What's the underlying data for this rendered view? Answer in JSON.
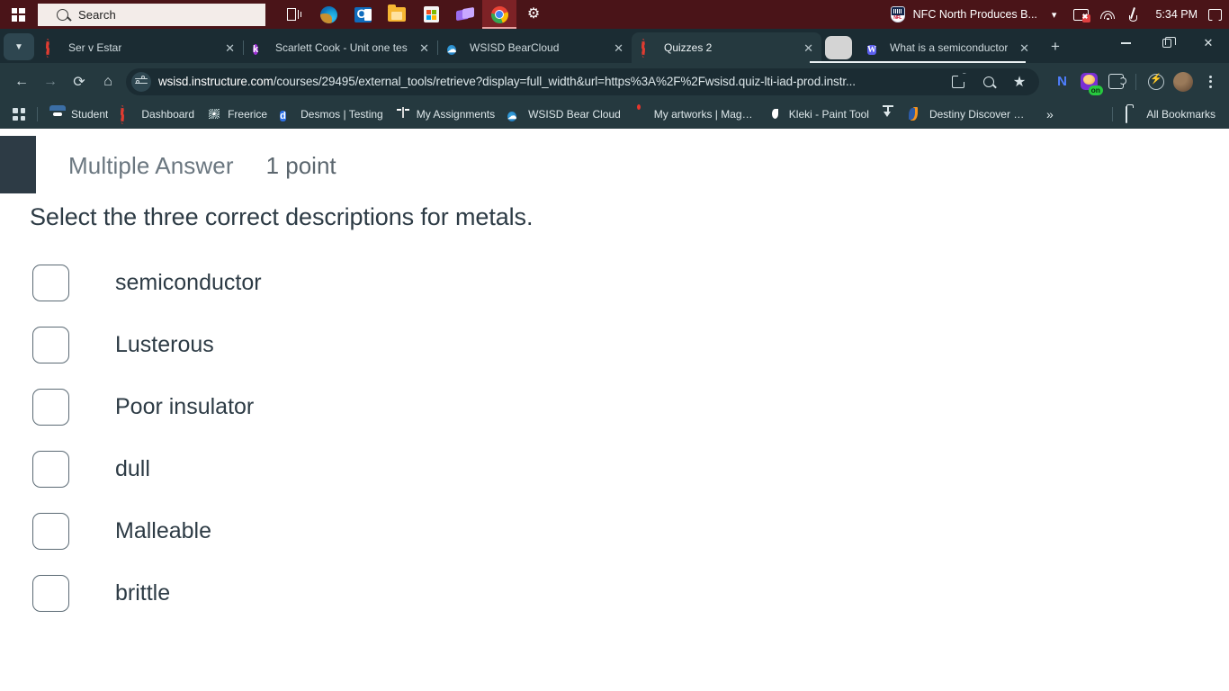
{
  "taskbar": {
    "start_icon": "windows-logo-icon",
    "search_placeholder": "Search",
    "apps": [
      {
        "name": "task-view-icon",
        "label": "Task View"
      },
      {
        "name": "edge-icon",
        "label": "Microsoft Edge"
      },
      {
        "name": "outlook-icon",
        "label": "Outlook"
      },
      {
        "name": "file-explorer-icon",
        "label": "File Explorer"
      },
      {
        "name": "microsoft-store-icon",
        "label": "Microsoft Store"
      },
      {
        "name": "clipchamp-icon",
        "label": "Clipchamp"
      },
      {
        "name": "chrome-icon",
        "label": "Google Chrome"
      },
      {
        "name": "settings-gear-icon",
        "label": "Settings"
      }
    ],
    "news": {
      "title": "NFC North Produces B...",
      "icon": "nfl-shield-icon"
    },
    "tray": [
      "monitor-disconnected-icon",
      "wifi-icon",
      "pen-icon"
    ],
    "clock": "5:34 PM",
    "notification_icon": "notification-icon"
  },
  "browser": {
    "tabs": [
      {
        "title": "Ser v Estar",
        "favicon": "canvas-icon",
        "active": false
      },
      {
        "title": "Scarlett Cook - Unit one tes",
        "favicon": "kami-icon",
        "active": false
      },
      {
        "title": "WSISD BearCloud",
        "favicon": "bearcloud-icon",
        "active": false
      },
      {
        "title": "Quizzes 2",
        "favicon": "canvas-icon",
        "active": true
      },
      {
        "title": "What is a semiconductor? S",
        "favicon": "word-icon",
        "active": false
      }
    ],
    "new_tab_label": "+",
    "window_controls": {
      "minimize": "minimize-icon",
      "maximize": "maximize-icon",
      "close": "close-icon"
    },
    "toolbar": {
      "back": "back-arrow-icon",
      "forward": "forward-arrow-icon",
      "reload": "reload-icon",
      "home": "home-icon",
      "url_prefix": "wsisd.instructure.com",
      "url_rest": "/courses/29495/external_tools/retrieve?display=full_width&url=https%3A%2F%2Fwsisd.quiz-lti-iad-prod.instr...",
      "site_settings_icon": "site-settings-icon",
      "split_view_icon": "open-in-new-icon",
      "zoom_icon": "zoom-icon",
      "bookmark_star": "★",
      "extensions": [
        {
          "name": "nordvpn-extension-icon",
          "label": "N"
        },
        {
          "name": "grammarly-extension-icon",
          "badge": "on"
        },
        {
          "name": "extensions-puzzle-icon"
        },
        {
          "name": "honey-extension-icon"
        }
      ],
      "profile_icon": "profile-avatar",
      "menu_icon": "chrome-menu-icon"
    },
    "bookmarks": {
      "apps_icon": "bookmark-apps-icon",
      "items": [
        {
          "label": "Student",
          "icon": "student-icon"
        },
        {
          "label": "Dashboard",
          "icon": "canvas-icon"
        },
        {
          "label": "Freerice",
          "icon": "freerice-icon"
        },
        {
          "label": "Desmos | Testing",
          "icon": "desmos-icon"
        },
        {
          "label": "My Assignments",
          "icon": "book-icon"
        },
        {
          "label": "WSISD Bear Cloud",
          "icon": "bearcloud-icon"
        },
        {
          "label": "My artworks | Magma",
          "icon": "magma-icon"
        },
        {
          "label": "Kleki - Paint Tool",
          "icon": "kleki-icon"
        },
        {
          "label": "",
          "icon": "downloads-icon"
        },
        {
          "label": "Destiny Discover Ho...",
          "icon": "destiny-icon"
        }
      ],
      "overflow_label": "»",
      "all_bookmarks_label": "All Bookmarks",
      "all_bookmarks_icon": "folder-icon"
    }
  },
  "quiz": {
    "question_type": "Multiple Answer",
    "points": "1 point",
    "prompt": "Select the three correct descriptions for metals.",
    "choices": [
      {
        "label": "semiconductor",
        "checked": false
      },
      {
        "label": "Lusterous",
        "checked": false
      },
      {
        "label": "Poor insulator",
        "checked": false
      },
      {
        "label": "dull",
        "checked": false
      },
      {
        "label": "Malleable",
        "checked": false
      },
      {
        "label": "brittle",
        "checked": false
      }
    ]
  },
  "colors": {
    "taskbar_bg": "#4a1418",
    "chrome_tabstrip": "#1b2c33",
    "chrome_toolbar": "#25393f",
    "canvas_dark": "#2d3b45",
    "page_bg": "#ffffff"
  }
}
